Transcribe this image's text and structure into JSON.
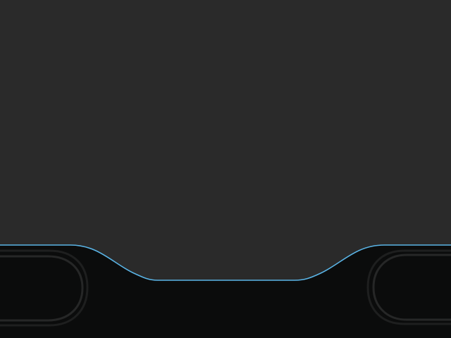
{
  "theme": {
    "background": "#2a2a2a",
    "bar_fill": "#0b0c0c",
    "accent_line": "#5ab4e6",
    "key_outline_outer": "#1e1f1f",
    "key_outline_inner": "#262727"
  },
  "bottom_bar": {
    "left_key": {
      "icon": "soft-key-left",
      "label": ""
    },
    "center_notch": {
      "label": ""
    },
    "right_key": {
      "icon": "soft-key-right",
      "label": ""
    }
  }
}
